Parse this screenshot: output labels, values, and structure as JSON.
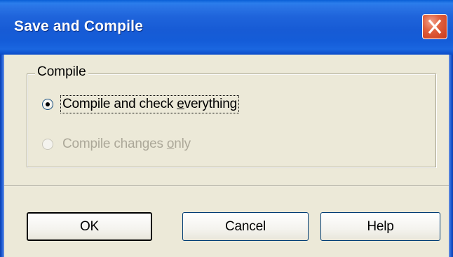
{
  "window": {
    "title": "Save and Compile",
    "close_icon": "close-icon"
  },
  "group": {
    "legend": "Compile",
    "options": [
      {
        "label_before": "Compile and check ",
        "label_underlined": "e",
        "label_after": "verything",
        "checked": true,
        "enabled": true
      },
      {
        "label_before": "Compile changes ",
        "label_underlined": "o",
        "label_after": "nly",
        "checked": false,
        "enabled": false
      }
    ]
  },
  "buttons": {
    "ok": "OK",
    "cancel": "Cancel",
    "help": "Help"
  },
  "colors": {
    "titlebar": "#1F64DB",
    "dialog_bg": "#ECE9D8",
    "close_button": "#E0603E",
    "disabled_text": "#ACA899"
  }
}
